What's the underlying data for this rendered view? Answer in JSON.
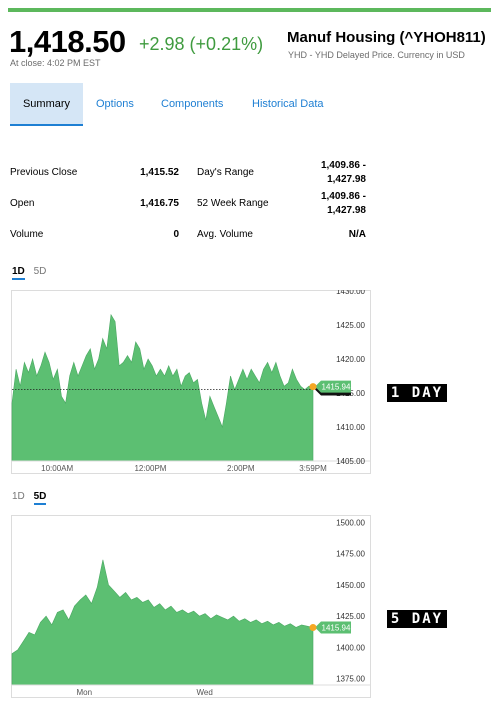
{
  "quote": {
    "price": "1,418.50",
    "change": "+2.98 (+0.21%)",
    "close_note": "At close: 4:02 PM EST",
    "name": "Manuf Housing (^YHOH811)",
    "subtitle": "YHD - YHD Delayed Price. Currency in USD"
  },
  "tabs": [
    {
      "label": "Summary",
      "active": true
    },
    {
      "label": "Options"
    },
    {
      "label": "Components"
    },
    {
      "label": "Historical Data"
    }
  ],
  "stats": {
    "previous_close_label": "Previous Close",
    "previous_close": "1,415.52",
    "open_label": "Open",
    "open": "1,416.75",
    "volume_label": "Volume",
    "volume": "0",
    "days_range_label": "Day's Range",
    "days_range_line1": "1,409.86 -",
    "days_range_line2": "1,427.98",
    "week52_label": "52 Week Range",
    "week52_line1": "1,409.86 -",
    "week52_line2": "1,427.98",
    "avg_volume_label": "Avg. Volume",
    "avg_volume": "N/A"
  },
  "range_tabs_1": [
    "1D",
    "5D"
  ],
  "range_tabs_2": [
    "1D",
    "5D"
  ],
  "badges": {
    "one_day": "1 DAY",
    "five_day": "5 DAY"
  },
  "colors": {
    "accent": "#5cb85c",
    "fill": "#5cbf72",
    "link": "#1e7fd3",
    "marker": "#f5a623"
  },
  "chart_data": [
    {
      "type": "area",
      "ylim": [
        1405,
        1430
      ],
      "yticks": [
        "1430.00",
        "1425.00",
        "1420.00",
        "1415.00",
        "1410.00",
        "1405.00"
      ],
      "xticks": [
        "10:00AM",
        "12:00PM",
        "2:00PM",
        "3:59PM"
      ],
      "current_label": "1415.94",
      "prev_close_label": "1415.52",
      "prev_close": 1415.52,
      "series": [
        {
          "values": [
            1413.5,
            1418.5,
            1416,
            1419.5,
            1418,
            1420,
            1417.5,
            1419,
            1421,
            1419.5,
            1417,
            1418.5,
            1414.5,
            1413.5,
            1417.5,
            1419.5,
            1417.5,
            1419,
            1420.5,
            1421.5,
            1418.5,
            1420,
            1423,
            1421.5,
            1426.5,
            1425.5,
            1419,
            1419.5,
            1420.5,
            1419.5,
            1422.5,
            1421.5,
            1418.5,
            1420,
            1419,
            1417.5,
            1418.5,
            1417.5,
            1419,
            1417.5,
            1418.5,
            1416,
            1417.5,
            1418,
            1416.5,
            1417,
            1413.5,
            1411,
            1414.5,
            1413,
            1411.5,
            1410,
            1413.5,
            1417.5,
            1415.5,
            1417,
            1418.5,
            1417,
            1418.5,
            1417.5,
            1416.5,
            1418.5,
            1419.5,
            1418,
            1419.5,
            1417.5,
            1416,
            1416.5,
            1418.5,
            1417,
            1416,
            1415.5,
            1416,
            1415.94
          ]
        }
      ]
    },
    {
      "type": "area",
      "ylim": [
        1370,
        1505
      ],
      "yticks": [
        "1500.00",
        "1475.00",
        "1450.00",
        "1425.00",
        "1400.00",
        "1375.00"
      ],
      "xticks": [
        "Mon",
        "Wed"
      ],
      "current_label": "1415.94",
      "series": [
        {
          "values": [
            1395,
            1398,
            1405,
            1412,
            1410,
            1420,
            1425,
            1418,
            1428,
            1430,
            1422,
            1433,
            1438,
            1442,
            1435,
            1448,
            1470,
            1450,
            1445,
            1440,
            1444,
            1438,
            1440,
            1436,
            1438,
            1432,
            1435,
            1430,
            1433,
            1428,
            1430,
            1427,
            1429,
            1425,
            1427,
            1423,
            1426,
            1424,
            1422,
            1425,
            1421,
            1423,
            1420,
            1422,
            1419,
            1421,
            1418,
            1420,
            1417,
            1419,
            1416,
            1418,
            1417,
            1415.94
          ]
        }
      ]
    }
  ]
}
